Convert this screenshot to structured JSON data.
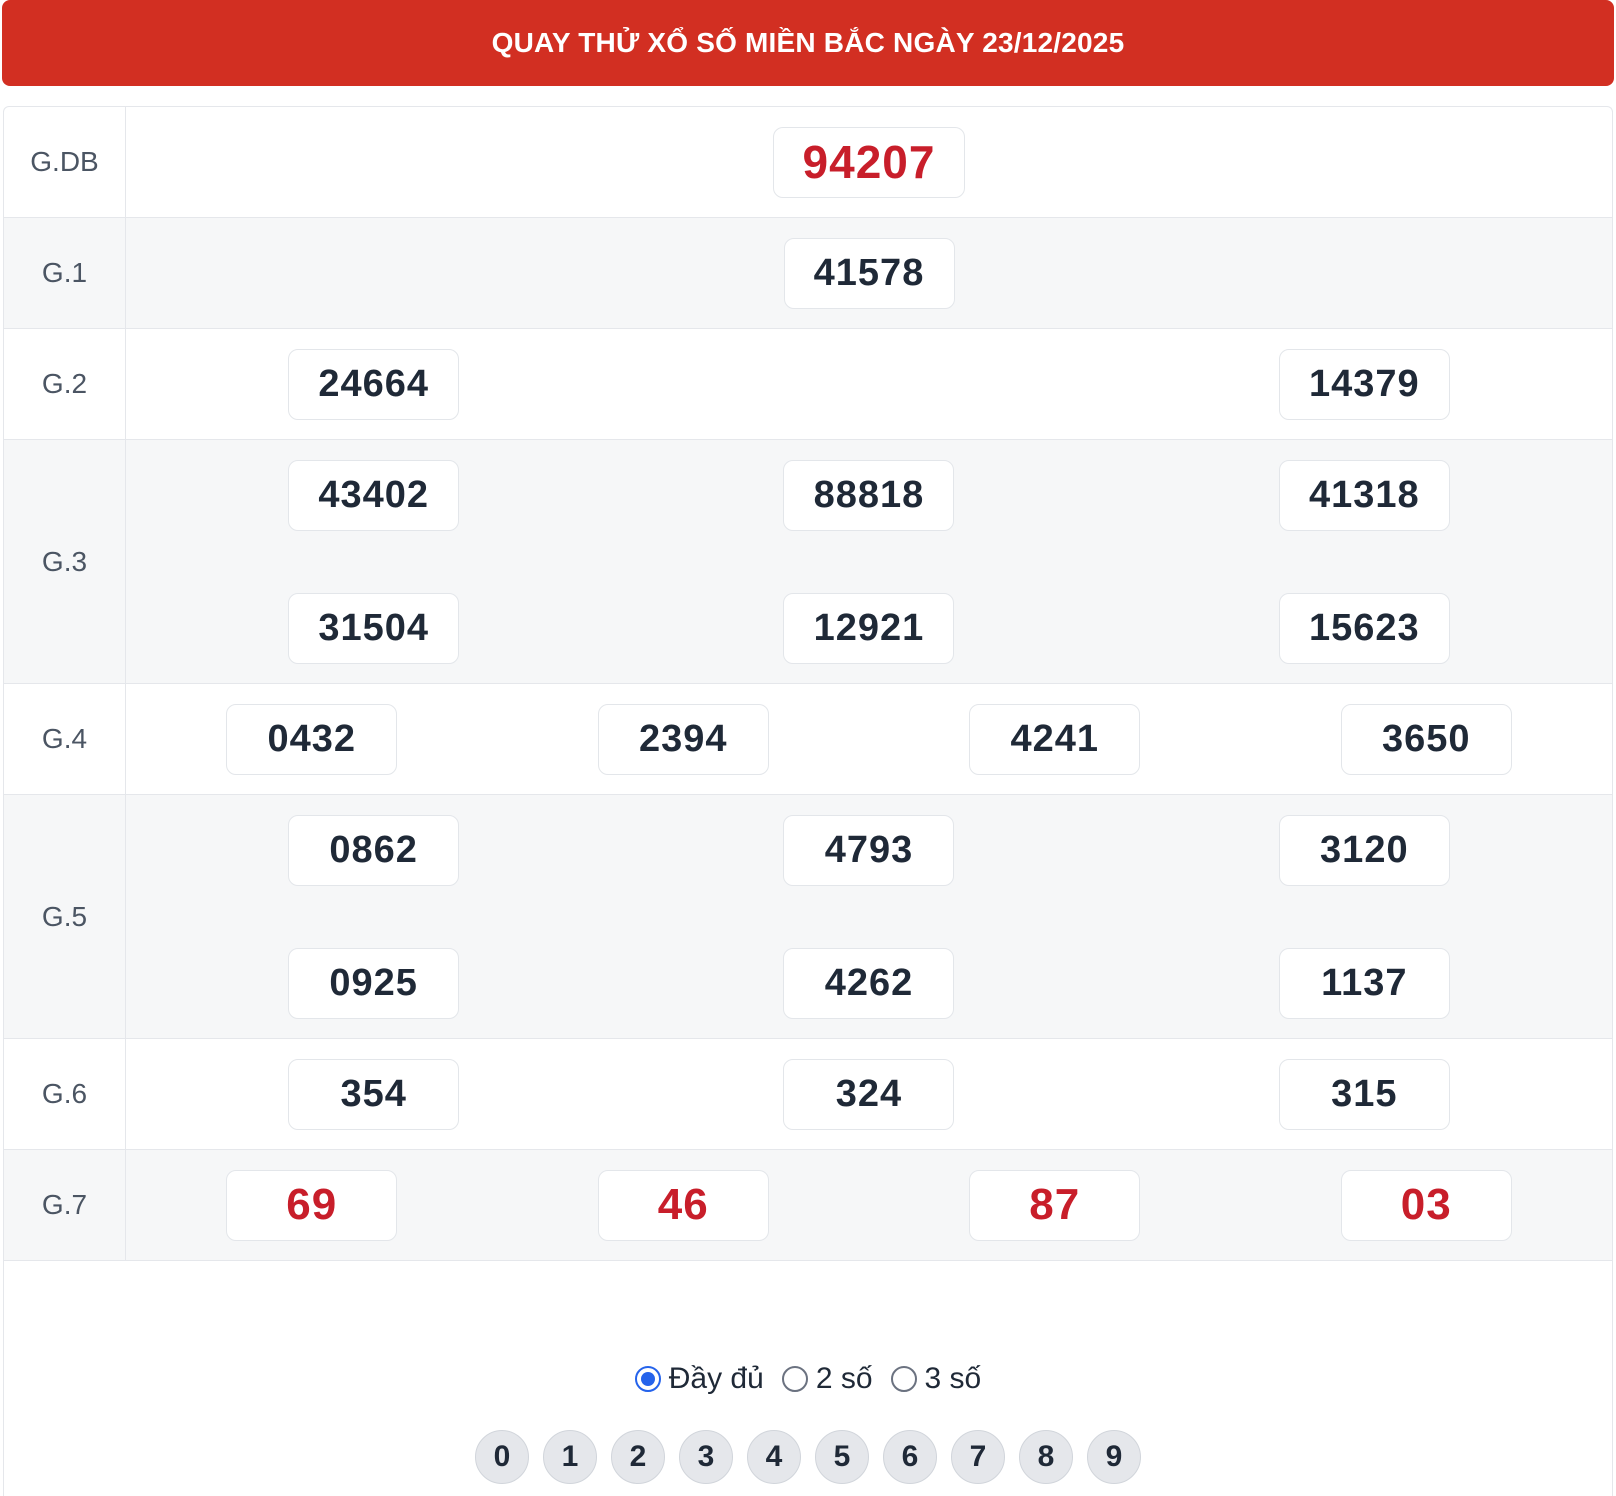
{
  "header": {
    "title": "QUAY THỬ XỔ SỐ MIỀN BẮC NGÀY 23/12/2025"
  },
  "accent_color": "#d22f22",
  "prizes": [
    {
      "label": "G.DB",
      "numbers": [
        "94207"
      ]
    },
    {
      "label": "G.1",
      "numbers": [
        "41578"
      ]
    },
    {
      "label": "G.2",
      "numbers": [
        "24664",
        "14379"
      ]
    },
    {
      "label": "G.3",
      "numbers": [
        "43402",
        "88818",
        "41318",
        "31504",
        "12921",
        "15623"
      ]
    },
    {
      "label": "G.4",
      "numbers": [
        "0432",
        "2394",
        "4241",
        "3650"
      ]
    },
    {
      "label": "G.5",
      "numbers": [
        "0862",
        "4793",
        "3120",
        "0925",
        "4262",
        "1137"
      ]
    },
    {
      "label": "G.6",
      "numbers": [
        "354",
        "324",
        "315"
      ]
    },
    {
      "label": "G.7",
      "numbers": [
        "69",
        "46",
        "87",
        "03"
      ]
    }
  ],
  "display_options": {
    "selected": "Đầy đủ",
    "options": [
      "Đầy đủ",
      "2 số",
      "3 số"
    ]
  },
  "digit_filters": [
    "0",
    "1",
    "2",
    "3",
    "4",
    "5",
    "6",
    "7",
    "8",
    "9"
  ]
}
